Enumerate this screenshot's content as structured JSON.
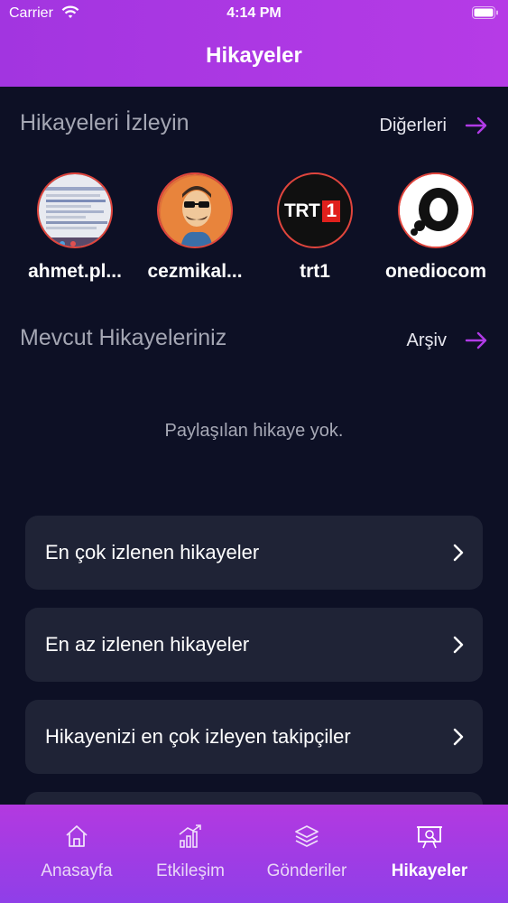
{
  "status_bar": {
    "carrier": "Carrier",
    "time": "4:14 PM"
  },
  "header": {
    "title": "Hikayeler"
  },
  "watch_section": {
    "title": "Hikayeleri İzleyin",
    "link": "Diğerleri"
  },
  "stories": [
    {
      "name": "ahmet.pl...",
      "avatar": "screenshot-thumbnail"
    },
    {
      "name": "cezmikal...",
      "avatar": "cartoon-man-sunglasses"
    },
    {
      "name": "trt1",
      "avatar": "trt1-logo",
      "logo_text": "TRT",
      "logo_number": "1"
    },
    {
      "name": "onediocom",
      "avatar": "onedio-logo"
    }
  ],
  "own_section": {
    "title": "Mevcut Hikayeleriniz",
    "link": "Arşiv",
    "empty_text": "Paylaşılan hikaye yok."
  },
  "menu": [
    {
      "label": "En çok izlenen hikayeler"
    },
    {
      "label": "En az izlenen hikayeler"
    },
    {
      "label": "Hikayenizi en çok izleyen takipçiler"
    }
  ],
  "tabs": [
    {
      "label": "Anasayfa",
      "icon": "home-icon"
    },
    {
      "label": "Etkileşim",
      "icon": "chart-icon"
    },
    {
      "label": "Gönderiler",
      "icon": "layers-icon"
    },
    {
      "label": "Hikayeler",
      "icon": "stories-icon",
      "active": true
    }
  ],
  "colors": {
    "accent": "#a235e0",
    "background": "#0d1025",
    "card": "#1f2336",
    "story_ring": "#e0453d",
    "arrow": "#b03be6"
  }
}
